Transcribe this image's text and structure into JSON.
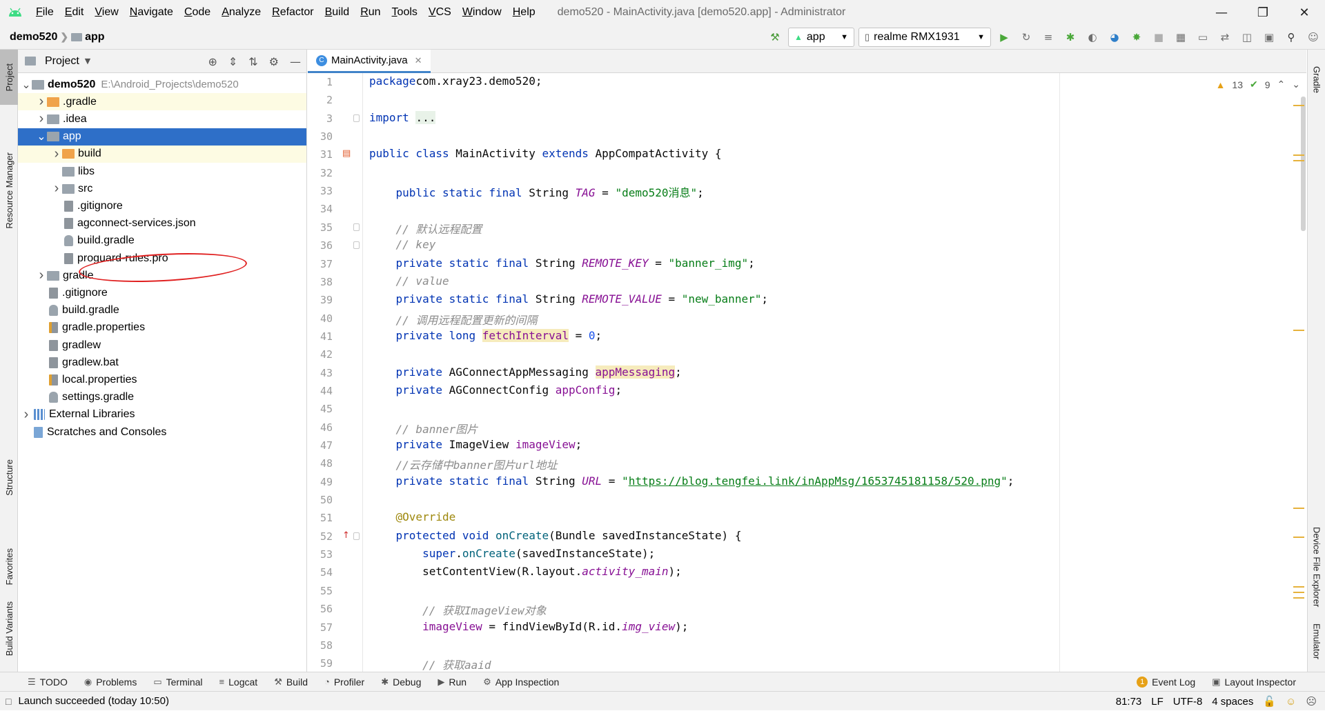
{
  "menubar": {
    "items": [
      "File",
      "Edit",
      "View",
      "Navigate",
      "Code",
      "Analyze",
      "Refactor",
      "Build",
      "Run",
      "Tools",
      "VCS",
      "Window",
      "Help"
    ],
    "window_title": "demo520 - MainActivity.java [demo520.app] - Administrator",
    "controls": [
      "minimize-icon",
      "restore-icon",
      "close-icon"
    ]
  },
  "navbar": {
    "project": "demo520",
    "module": "app",
    "run_config": "app",
    "device": "realme RMX1931"
  },
  "left_strip": {
    "tabs": [
      "Project",
      "Resource Manager",
      "Structure",
      "Favorites",
      "Build Variants"
    ]
  },
  "right_strip": {
    "tabs": [
      "Gradle",
      "Device File Explorer",
      "Emulator"
    ]
  },
  "project_panel": {
    "title": "Project",
    "tree": [
      {
        "label": "demo520",
        "hint": "E:\\Android_Projects\\demo520",
        "depth": 0,
        "arrow": "down",
        "icon": "module-folder"
      },
      {
        "label": ".gradle",
        "depth": 1,
        "arrow": "right",
        "icon": "folder-orange",
        "highlight": true
      },
      {
        "label": ".idea",
        "depth": 1,
        "arrow": "right",
        "icon": "folder-grey"
      },
      {
        "label": "app",
        "depth": 1,
        "arrow": "down",
        "icon": "folder-grey",
        "selected": true
      },
      {
        "label": "build",
        "depth": 2,
        "arrow": "right",
        "icon": "folder-orange",
        "highlight": true
      },
      {
        "label": "libs",
        "depth": 2,
        "arrow": "",
        "icon": "folder-grey"
      },
      {
        "label": "src",
        "depth": 2,
        "arrow": "right",
        "icon": "folder-grey"
      },
      {
        "label": ".gitignore",
        "depth": 2,
        "arrow": "",
        "icon": "file"
      },
      {
        "label": "agconnect-services.json",
        "depth": 2,
        "arrow": "",
        "icon": "file"
      },
      {
        "label": "build.gradle",
        "depth": 2,
        "arrow": "",
        "icon": "gradle"
      },
      {
        "label": "proguard-rules.pro",
        "depth": 2,
        "arrow": "",
        "icon": "file"
      },
      {
        "label": "gradle",
        "depth": 1,
        "arrow": "right",
        "icon": "folder-grey"
      },
      {
        "label": ".gitignore",
        "depth": 1,
        "arrow": "",
        "icon": "file"
      },
      {
        "label": "build.gradle",
        "depth": 1,
        "arrow": "",
        "icon": "gradle"
      },
      {
        "label": "gradle.properties",
        "depth": 1,
        "arrow": "",
        "icon": "properties"
      },
      {
        "label": "gradlew",
        "depth": 1,
        "arrow": "",
        "icon": "file"
      },
      {
        "label": "gradlew.bat",
        "depth": 1,
        "arrow": "",
        "icon": "file"
      },
      {
        "label": "local.properties",
        "depth": 1,
        "arrow": "",
        "icon": "properties"
      },
      {
        "label": "settings.gradle",
        "depth": 1,
        "arrow": "",
        "icon": "gradle"
      },
      {
        "label": "External Libraries",
        "depth": 0,
        "arrow": "right",
        "icon": "library"
      },
      {
        "label": "Scratches and Consoles",
        "depth": 0,
        "arrow": "",
        "icon": "scratch"
      }
    ]
  },
  "editor": {
    "tab_label": "MainActivity.java",
    "warnings": "13",
    "checks": "9",
    "lines": [
      {
        "n": "1",
        "tokens": [
          [
            "kw",
            "package"
          ],
          [
            "",
            "com.xray23.demo520;"
          ]
        ]
      },
      {
        "n": "2",
        "tokens": []
      },
      {
        "n": "3",
        "tokens": [
          [
            "kw",
            "import"
          ],
          [
            "",
            " "
          ],
          [
            "fold",
            "..."
          ]
        ]
      },
      {
        "n": "30",
        "tokens": []
      },
      {
        "n": "31",
        "tokens": [
          [
            "kw",
            "public class"
          ],
          [
            "",
            " MainActivity "
          ],
          [
            "kw",
            "extends"
          ],
          [
            "",
            " AppCompatActivity {"
          ]
        ]
      },
      {
        "n": "32",
        "tokens": []
      },
      {
        "n": "33",
        "tokens": [
          [
            "",
            "    "
          ],
          [
            "kw",
            "public static final"
          ],
          [
            "",
            " String "
          ],
          [
            "stfld",
            "TAG"
          ],
          [
            "",
            " = "
          ],
          [
            "str",
            "\"demo520消息\""
          ],
          [
            "",
            ";"
          ]
        ]
      },
      {
        "n": "34",
        "tokens": []
      },
      {
        "n": "35",
        "tokens": [
          [
            "",
            "    "
          ],
          [
            "cmt",
            "// 默认远程配置"
          ]
        ]
      },
      {
        "n": "36",
        "tokens": [
          [
            "",
            "    "
          ],
          [
            "cmt",
            "// key"
          ]
        ]
      },
      {
        "n": "37",
        "tokens": [
          [
            "",
            "    "
          ],
          [
            "kw",
            "private static final"
          ],
          [
            "",
            " String "
          ],
          [
            "stfld",
            "REMOTE_KEY"
          ],
          [
            "",
            " = "
          ],
          [
            "str",
            "\"banner_img\""
          ],
          [
            "",
            ";"
          ]
        ]
      },
      {
        "n": "38",
        "tokens": [
          [
            "",
            "    "
          ],
          [
            "cmt",
            "// value"
          ]
        ]
      },
      {
        "n": "39",
        "tokens": [
          [
            "",
            "    "
          ],
          [
            "kw",
            "private static final"
          ],
          [
            "",
            " String "
          ],
          [
            "stfld",
            "REMOTE_VALUE"
          ],
          [
            "",
            " = "
          ],
          [
            "str",
            "\"new_banner\""
          ],
          [
            "",
            ";"
          ]
        ]
      },
      {
        "n": "40",
        "tokens": [
          [
            "",
            "    "
          ],
          [
            "cmt",
            "// 调用远程配置更新的间隔"
          ]
        ]
      },
      {
        "n": "41",
        "tokens": [
          [
            "",
            "    "
          ],
          [
            "kw",
            "private long"
          ],
          [
            "",
            " "
          ],
          [
            "warnfld",
            "fetchInterval"
          ],
          [
            "",
            " = "
          ],
          [
            "num",
            "0"
          ],
          [
            "",
            ";"
          ]
        ]
      },
      {
        "n": "42",
        "tokens": []
      },
      {
        "n": "43",
        "tokens": [
          [
            "",
            "    "
          ],
          [
            "kw",
            "private"
          ],
          [
            "",
            " AGConnectAppMessaging "
          ],
          [
            "warnfld",
            "appMessaging"
          ],
          [
            "",
            ";"
          ]
        ]
      },
      {
        "n": "44",
        "tokens": [
          [
            "",
            "    "
          ],
          [
            "kw",
            "private"
          ],
          [
            "",
            " AGConnectConfig "
          ],
          [
            "fld",
            "appConfig"
          ],
          [
            "",
            ";"
          ]
        ]
      },
      {
        "n": "45",
        "tokens": []
      },
      {
        "n": "46",
        "tokens": [
          [
            "",
            "    "
          ],
          [
            "cmt",
            "// banner图片"
          ]
        ]
      },
      {
        "n": "47",
        "tokens": [
          [
            "",
            "    "
          ],
          [
            "kw",
            "private"
          ],
          [
            "",
            " ImageView "
          ],
          [
            "fld",
            "imageView"
          ],
          [
            "",
            ";"
          ]
        ]
      },
      {
        "n": "48",
        "tokens": [
          [
            "",
            "    "
          ],
          [
            "cmt",
            "//云存储中banner图片url地址"
          ]
        ]
      },
      {
        "n": "49",
        "tokens": [
          [
            "",
            "    "
          ],
          [
            "kw",
            "private static final"
          ],
          [
            "",
            " String "
          ],
          [
            "stfld",
            "URL"
          ],
          [
            "",
            " = "
          ],
          [
            "str",
            "\""
          ],
          [
            "link",
            "https://blog.tengfei.link/inAppMsg/1653745181158/520.png"
          ],
          [
            "str",
            "\""
          ],
          [
            "",
            ";"
          ]
        ]
      },
      {
        "n": "50",
        "tokens": []
      },
      {
        "n": "51",
        "tokens": [
          [
            "",
            "    "
          ],
          [
            "ann",
            "@Override"
          ]
        ]
      },
      {
        "n": "52",
        "tokens": [
          [
            "",
            "    "
          ],
          [
            "kw",
            "protected void"
          ],
          [
            "",
            " "
          ],
          [
            "mth",
            "onCreate"
          ],
          [
            "",
            "(Bundle savedInstanceState) {"
          ]
        ]
      },
      {
        "n": "53",
        "tokens": [
          [
            "",
            "        "
          ],
          [
            "kw",
            "super"
          ],
          [
            "",
            "."
          ],
          [
            "mth",
            "onCreate"
          ],
          [
            "",
            "(savedInstanceState);"
          ]
        ]
      },
      {
        "n": "54",
        "tokens": [
          [
            "",
            "        setContentView(R.layout."
          ],
          [
            "stfld",
            "activity_main"
          ],
          [
            "",
            ");"
          ]
        ]
      },
      {
        "n": "55",
        "tokens": []
      },
      {
        "n": "56",
        "tokens": [
          [
            "",
            "        "
          ],
          [
            "cmt",
            "// 获取ImageView对象"
          ]
        ]
      },
      {
        "n": "57",
        "tokens": [
          [
            "",
            "        "
          ],
          [
            "fld",
            "imageView"
          ],
          [
            "",
            " = findViewById(R.id."
          ],
          [
            "stfld",
            "img_view"
          ],
          [
            "",
            ");"
          ]
        ]
      },
      {
        "n": "58",
        "tokens": []
      },
      {
        "n": "59",
        "tokens": [
          [
            "",
            "        "
          ],
          [
            "cmt",
            "// 获取aaid"
          ]
        ]
      }
    ]
  },
  "bottom_tools": {
    "left": [
      {
        "label": "TODO",
        "icon": "list-icon"
      },
      {
        "label": "Problems",
        "icon": "problems-icon"
      },
      {
        "label": "Terminal",
        "icon": "terminal-icon"
      },
      {
        "label": "Logcat",
        "icon": "logcat-icon"
      },
      {
        "label": "Build",
        "icon": "hammer-icon"
      },
      {
        "label": "Profiler",
        "icon": "profiler-icon"
      },
      {
        "label": "Debug",
        "icon": "bug-icon"
      },
      {
        "label": "Run",
        "icon": "play-icon"
      },
      {
        "label": "App Inspection",
        "icon": "inspection-icon"
      }
    ],
    "event_log": "Event Log",
    "event_log_count": "1",
    "layout_inspector": "Layout Inspector"
  },
  "status_bar": {
    "message": "Launch succeeded (today 10:50)",
    "position": "81:73",
    "line_sep": "LF",
    "encoding": "UTF-8",
    "indent": "4 spaces"
  }
}
